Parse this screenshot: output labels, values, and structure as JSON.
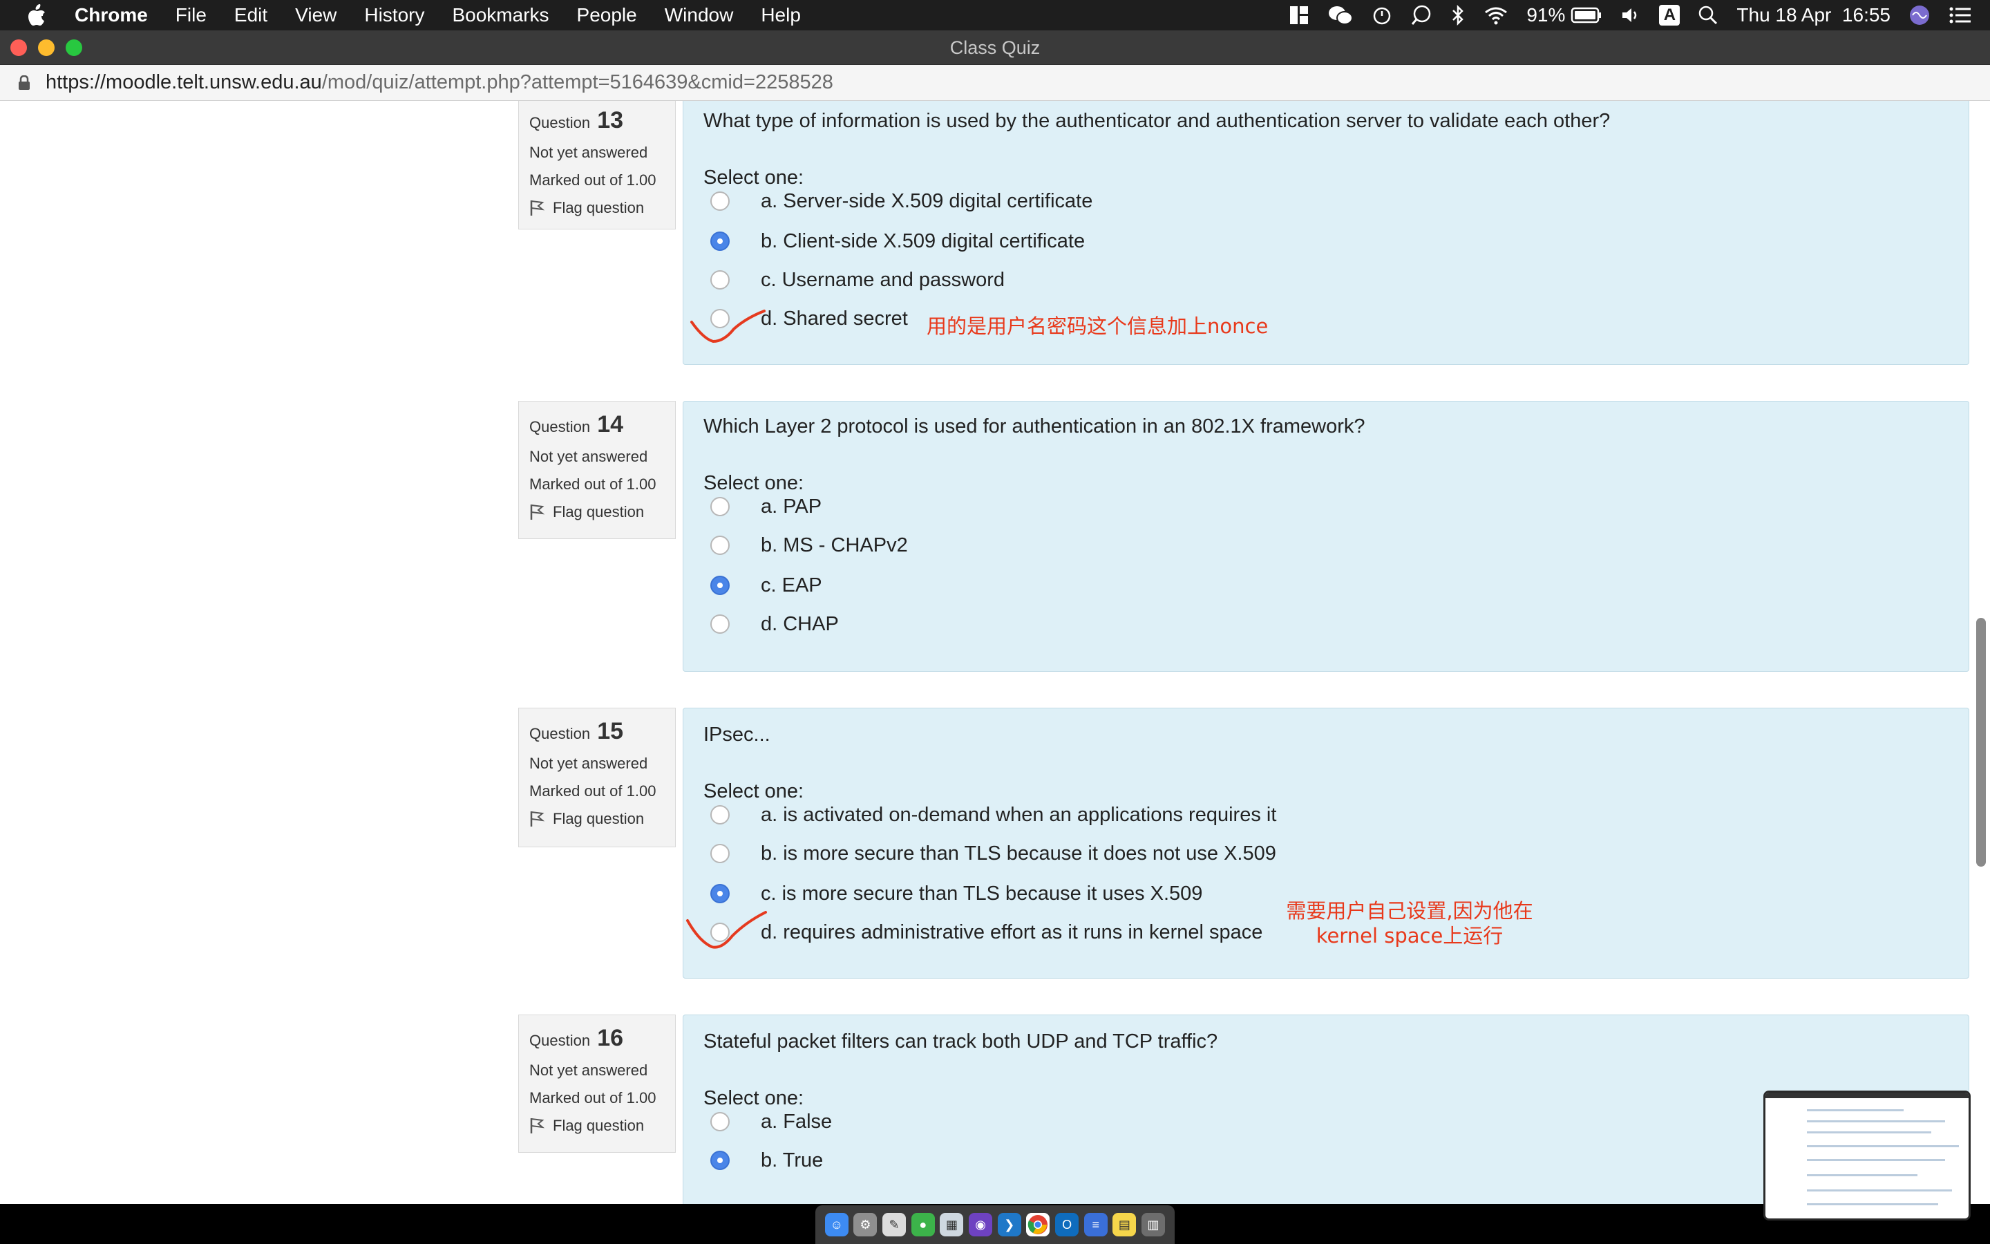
{
  "menubar": {
    "app": "Chrome",
    "items": [
      "File",
      "Edit",
      "View",
      "History",
      "Bookmarks",
      "People",
      "Window",
      "Help"
    ],
    "battery": "91%",
    "input_source": "A",
    "datetime": "Thu 18 Apr  16:55"
  },
  "window": {
    "title": "Class Quiz"
  },
  "urlbar": {
    "host": "https://moodle.telt.unsw.edu.au",
    "path": "/mod/quiz/attempt.php?attempt=5164639&cmid=2258528"
  },
  "questions": [
    {
      "label": "Question",
      "number": "13",
      "state": "Not yet answered",
      "marked": "Marked out of 1.00",
      "flag": "Flag question",
      "text": "What type of information is used by the authenticator and authentication server to validate each other?",
      "select": "Select one:",
      "options": [
        {
          "label": "a. Server-side X.509 digital certificate",
          "selected": false
        },
        {
          "label": "b. Client-side X.509 digital certificate",
          "selected": true
        },
        {
          "label": "c. Username and password",
          "selected": false
        },
        {
          "label": "d. Shared secret",
          "selected": false
        }
      ],
      "note": "用的是用户名密码这个信息加上nonce"
    },
    {
      "label": "Question",
      "number": "14",
      "state": "Not yet answered",
      "marked": "Marked out of 1.00",
      "flag": "Flag question",
      "text": "Which Layer 2 protocol is used for authentication in an 802.1X framework?",
      "select": "Select one:",
      "options": [
        {
          "label": "a. PAP",
          "selected": false
        },
        {
          "label": "b. MS - CHAPv2",
          "selected": false
        },
        {
          "label": "c. EAP",
          "selected": true
        },
        {
          "label": "d. CHAP",
          "selected": false
        }
      ]
    },
    {
      "label": "Question",
      "number": "15",
      "state": "Not yet answered",
      "marked": "Marked out of 1.00",
      "flag": "Flag question",
      "text": "IPsec...",
      "select": "Select one:",
      "options": [
        {
          "label": "a. is activated on-demand when an applications requires it",
          "selected": false
        },
        {
          "label": "b. is more secure than TLS because it does not use X.509",
          "selected": false
        },
        {
          "label": "c. is more secure than TLS because it uses X.509",
          "selected": true
        },
        {
          "label": "d. requires administrative effort as it runs in kernel space",
          "selected": false
        }
      ],
      "note_line1": "需要用户自己设置,因为他在",
      "note_line2": "kernel space上运行"
    },
    {
      "label": "Question",
      "number": "16",
      "state": "Not yet answered",
      "marked": "Marked out of 1.00",
      "flag": "Flag question",
      "text": "Stateful packet filters can track both UDP and TCP traffic?",
      "select": "Select one:",
      "options": [
        {
          "label": "a. False",
          "selected": false
        },
        {
          "label": "b. True",
          "selected": true
        }
      ]
    }
  ],
  "colors": {
    "accent_radio": "#4a85e8",
    "annotation": "#e8391b",
    "question_bg": "#def0f7"
  }
}
